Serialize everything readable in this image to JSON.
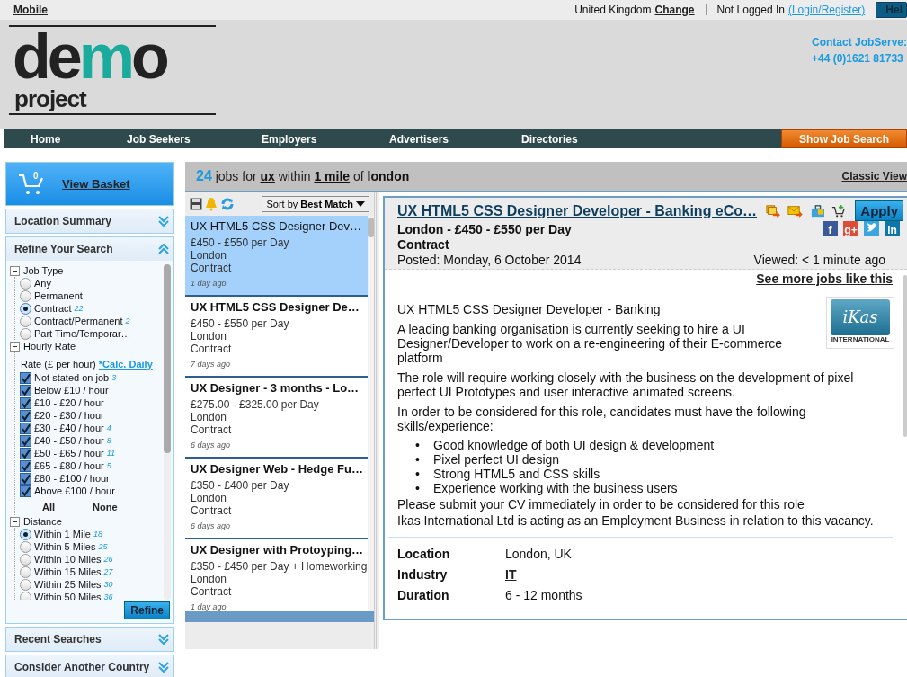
{
  "top_bar": {
    "mobile_link": "Mobile",
    "country": "United Kingdom",
    "change_link": "Change",
    "login_status": "Not Logged In",
    "login_link": "(Login/Register)",
    "help_button": "Hel"
  },
  "header": {
    "logo": {
      "parts": [
        {
          "text": "de",
          "accent": false
        },
        {
          "text": "m",
          "accent": true
        },
        {
          "text": "o",
          "accent": false
        }
      ],
      "tagline": "project"
    },
    "contact_label": "Contact JobServe:",
    "contact_phone": "+44 (0)1621 81733"
  },
  "nav": {
    "items": [
      "Home",
      "Job Seekers",
      "Employers",
      "Advertisers",
      "Directories"
    ],
    "search_button": "Show Job Search"
  },
  "sidebar": {
    "basket": {
      "count": "0",
      "link": "View Basket"
    },
    "sections": [
      {
        "title": "Location Summary",
        "expanded": false
      },
      {
        "title": "Refine Your Search",
        "expanded": true,
        "groups": [
          {
            "title": "Job Type",
            "expanded": true,
            "options": [
              {
                "kind": "radio",
                "label": "Any",
                "selected": false
              },
              {
                "kind": "radio",
                "label": "Permanent",
                "selected": false
              },
              {
                "kind": "radio",
                "label": "Contract",
                "count": "22",
                "selected": true
              },
              {
                "kind": "radio",
                "label": "Contract/Permanent",
                "count": "2",
                "selected": false
              },
              {
                "kind": "radio",
                "label": "Part Time/Temporar…",
                "selected": false
              }
            ]
          },
          {
            "title": "Hourly Rate",
            "expanded": true,
            "note": "Rate (£ per hour)",
            "note_link": "*Calc. Daily",
            "options": [
              {
                "kind": "checkbox",
                "label": "Not stated on job",
                "count": "3",
                "checked": true
              },
              {
                "kind": "checkbox",
                "label": "Below £10 / hour",
                "checked": true
              },
              {
                "kind": "checkbox",
                "label": "£10 - £20 / hour",
                "checked": true
              },
              {
                "kind": "checkbox",
                "label": "£20 - £30 / hour",
                "checked": true
              },
              {
                "kind": "checkbox",
                "label": "£30 - £40 / hour",
                "count": "4",
                "checked": true
              },
              {
                "kind": "checkbox",
                "label": "£40 - £50 / hour",
                "count": "8",
                "checked": true
              },
              {
                "kind": "checkbox",
                "label": "£50 - £65 / hour",
                "count": "11",
                "checked": true
              },
              {
                "kind": "checkbox",
                "label": "£65 - £80 / hour",
                "count": "5",
                "checked": true
              },
              {
                "kind": "checkbox",
                "label": "£80 - £100 / hour",
                "checked": true
              },
              {
                "kind": "checkbox",
                "label": "Above £100 / hour",
                "checked": true
              }
            ],
            "all_link": "All",
            "none_link": "None"
          },
          {
            "title": "Distance",
            "expanded": true,
            "options": [
              {
                "kind": "radio",
                "label": "Within 1 Mile",
                "count": "18",
                "selected": true
              },
              {
                "kind": "radio",
                "label": "Within 5 Miles",
                "count": "25",
                "selected": false
              },
              {
                "kind": "radio",
                "label": "Within 10 Miles",
                "count": "26",
                "selected": false
              },
              {
                "kind": "radio",
                "label": "Within 15 Miles",
                "count": "27",
                "selected": false
              },
              {
                "kind": "radio",
                "label": "Within 25 Miles",
                "count": "30",
                "selected": false
              },
              {
                "kind": "radio",
                "label": "Within 50 Miles",
                "count": "36",
                "selected": false
              }
            ]
          }
        ],
        "refine_button": "Refine"
      },
      {
        "title": "Recent Searches",
        "expanded": false
      },
      {
        "title": "Consider Another Country",
        "expanded": false
      }
    ]
  },
  "results": {
    "summary": [
      {
        "kind": "count",
        "text": "24"
      },
      {
        "kind": "plain",
        "text": " jobs for "
      },
      {
        "kind": "link",
        "text": "ux"
      },
      {
        "kind": "plain",
        "text": " within "
      },
      {
        "kind": "link",
        "text": "1 mile"
      },
      {
        "kind": "plain",
        "text": " of "
      },
      {
        "kind": "bold",
        "text": "london"
      }
    ],
    "classic_view": "Classic View",
    "sort": {
      "label": "Sort by",
      "value": "Best Match"
    },
    "jobs": [
      {
        "title": "UX HTML5 CSS Designer Dev…",
        "salary": "£450 - £550 per Day",
        "location": "London",
        "type": "Contract",
        "age": "1 day ago",
        "selected": true
      },
      {
        "title": "UX HTML5 CSS Designer De…",
        "salary": "£450 - £550 per Day",
        "location": "London",
        "type": "Contract",
        "age": "7 days ago",
        "selected": false
      },
      {
        "title": "UX Designer - 3 months - Lo…",
        "salary": "£275.00 - £325.00 per Day",
        "location": "London",
        "type": "Contract",
        "age": "6 days ago",
        "selected": false
      },
      {
        "title": "UX Designer Web - Hedge Fu…",
        "salary": "£350 - £400 per Day",
        "location": "London",
        "type": "Contract",
        "age": "6 days ago",
        "selected": false
      },
      {
        "title": "UX Designer with Protoyping…",
        "salary": "£350 - £450 per Day + Homeworking",
        "location": "London",
        "type": "Contract",
        "age": "1 day ago",
        "selected": false
      }
    ]
  },
  "detail": {
    "title": "UX HTML5 CSS Designer Developer - Banking eCo…",
    "subtitle": "London - £450 - £550 per Day",
    "type": "Contract",
    "posted": "Posted: Monday, 6 October 2014",
    "viewed": "Viewed: < 1 minute ago",
    "apply_button": "Apply",
    "social": [
      {
        "kind": "letter",
        "glyph": "f",
        "color": "#3b5998"
      },
      {
        "kind": "letter",
        "glyph": "g+",
        "color": "#dd4b39"
      },
      {
        "kind": "bird",
        "color": "#3aa6e0"
      },
      {
        "kind": "letter",
        "glyph": "in",
        "color": "#0e76a8"
      }
    ],
    "see_more": "See more jobs like this",
    "company_logo": {
      "name": "iKas",
      "sub": "INTERNATIONAL"
    },
    "body": [
      {
        "kind": "paragraph",
        "text": "UX HTML5 CSS Designer Developer - Banking"
      },
      {
        "kind": "paragraph",
        "text": "A leading banking organisation is currently seeking to hire a UI Designer/Developer to work on a re-engineering of their E-commerce platform"
      },
      {
        "kind": "paragraph",
        "text": "The role will require working closely with the business on the development of pixel perfect UI Prototypes and user interactive animated screens."
      },
      {
        "kind": "paragraph",
        "text": "In order to be considered for this role, candidates must have the following skills/experience:"
      },
      {
        "kind": "list",
        "bullet": "•",
        "items": [
          "Good knowledge of both UI design & development",
          "Pixel perfect UI design",
          "Strong HTML5 and CSS skills",
          "Experience working with the business users"
        ]
      },
      {
        "kind": "line",
        "text": "Please submit your CV immediately in order to be considered for this role"
      },
      {
        "kind": "line",
        "text": "Ikas International Ltd is acting as an Employment Business in relation to this vacancy."
      }
    ],
    "facts": [
      {
        "label": "Location",
        "value": "London, UK",
        "link": false
      },
      {
        "label": "Industry",
        "value": "IT",
        "link": true
      },
      {
        "label": "Duration",
        "value": "6 - 12 months",
        "link": false
      }
    ]
  }
}
